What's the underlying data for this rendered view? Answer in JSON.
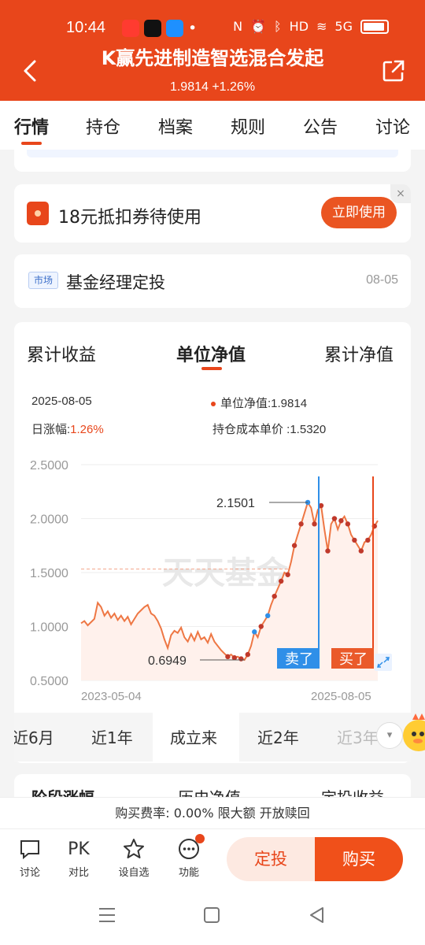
{
  "status_bar": {
    "time": "10:44",
    "network": "5G"
  },
  "header": {
    "fund_name": "K赢先进制造智选混合发起",
    "nav_change": "1.9814 +1.26%"
  },
  "tabs": [
    "行情",
    "持仓",
    "档案",
    "规则",
    "公告",
    "讨论"
  ],
  "coupon": {
    "text": "18元抵扣券待使用",
    "button": "立即使用",
    "close": "×"
  },
  "market": {
    "tag": "市场",
    "title": "基金经理定投",
    "date": "08-05"
  },
  "chart_tabs": [
    "累计收益",
    "单位净值",
    "累计净值"
  ],
  "chart_info": {
    "date": "2025-08-05",
    "nav_label": "单位净值:",
    "nav_value": "1.9814",
    "daily_label": "日涨幅:",
    "daily_value": "1.26%",
    "cost_label": "持仓成本单价 :",
    "cost_value": "1.5320"
  },
  "chart_data": {
    "type": "line",
    "y_ticks": [
      "2.5000",
      "2.0000",
      "1.5000",
      "1.0000",
      "0.5000"
    ],
    "ylim": [
      0.5,
      2.5
    ],
    "x_start": "2023-05-04",
    "x_end": "2025-08-05",
    "watermark": "天天基金",
    "max_label": "2.1501",
    "min_label": "0.6949",
    "cost_line": 1.532,
    "sell_label": "卖了",
    "buy_label": "买了",
    "values": [
      1.03,
      1.05,
      1.01,
      1.04,
      1.07,
      1.22,
      1.18,
      1.1,
      1.14,
      1.08,
      1.12,
      1.06,
      1.1,
      1.05,
      1.09,
      1.02,
      1.07,
      1.12,
      1.15,
      1.18,
      1.2,
      1.12,
      1.1,
      1.05,
      0.98,
      0.88,
      0.8,
      0.92,
      0.96,
      0.94,
      0.99,
      0.9,
      0.86,
      0.93,
      0.87,
      0.95,
      0.88,
      0.9,
      0.85,
      0.93,
      0.86,
      0.82,
      0.78,
      0.75,
      0.72,
      0.74,
      0.71,
      0.72,
      0.7,
      0.69,
      0.74,
      0.82,
      0.95,
      0.9,
      1.0,
      1.05,
      1.1,
      1.2,
      1.28,
      1.35,
      1.42,
      1.5,
      1.48,
      1.6,
      1.75,
      1.85,
      1.95,
      2.05,
      2.15,
      2.1,
      1.95,
      2.08,
      2.12,
      1.9,
      1.7,
      1.95,
      2.0,
      1.9,
      1.98,
      2.02,
      1.95,
      1.85,
      1.8,
      1.75,
      1.7,
      1.78,
      1.8,
      1.85,
      1.93,
      1.98
    ]
  },
  "periods": [
    "近6月",
    "近1年",
    "成立来",
    "近2年",
    "近3年"
  ],
  "next_section": [
    "阶段涨幅",
    "历史净值",
    "定投收益"
  ],
  "fee_bar": "购买费率:  0.00%  限大额  开放赎回",
  "bottom_bar": {
    "items": [
      {
        "icon": "chat-icon",
        "label": "讨论"
      },
      {
        "icon": "pk-icon",
        "label": "对比",
        "glyph": "PK"
      },
      {
        "icon": "star-add-icon",
        "label": "设自选"
      },
      {
        "icon": "more-dots-icon",
        "label": "功能"
      }
    ],
    "dingtou": "定投",
    "buy": "购买"
  },
  "colors": {
    "brand": "#e8461b",
    "line": "#ee7744",
    "blue_marker": "#2f8fe8"
  }
}
